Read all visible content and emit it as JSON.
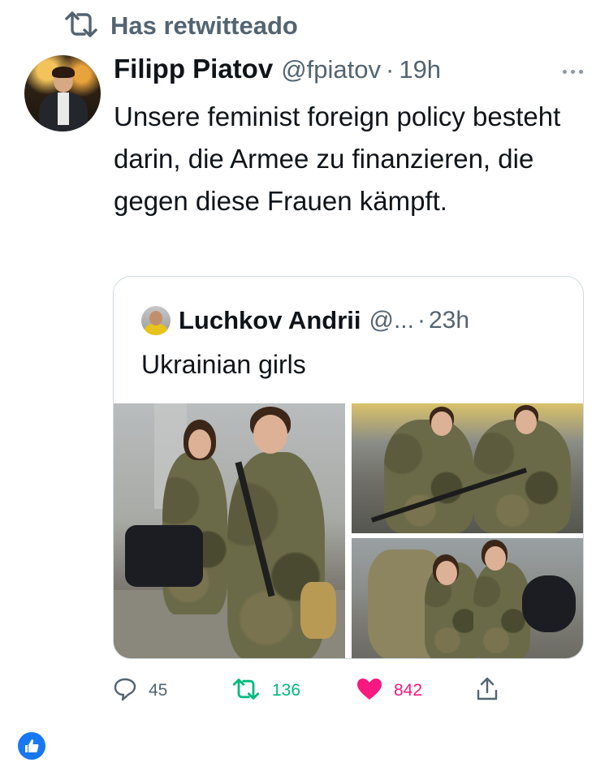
{
  "retweet": {
    "label": "Has retwitteado"
  },
  "tweet": {
    "author_name": "Filipp Piatov",
    "author_handle": "@fpiatov",
    "separator": "·",
    "time": "19h",
    "text": "Unsere feminist foreign policy besteht darin, die Armee zu finanzieren, die gegen diese Frauen kämpft."
  },
  "quote": {
    "author_name": "Luchkov Andrii",
    "author_handle": "@...",
    "separator": "·",
    "time": "23h",
    "text": "Ukrainian girls"
  },
  "actions": {
    "replies": "45",
    "retweets": "136",
    "likes": "842"
  },
  "colors": {
    "retweet_green": "#00ba7c",
    "like_pink": "#f91880",
    "gray_text": "#536471",
    "facebook_blue": "#1877f2"
  },
  "icons": [
    "retweet-icon",
    "more-icon",
    "reply-icon",
    "heart-icon",
    "share-icon",
    "facebook-like-icon"
  ]
}
